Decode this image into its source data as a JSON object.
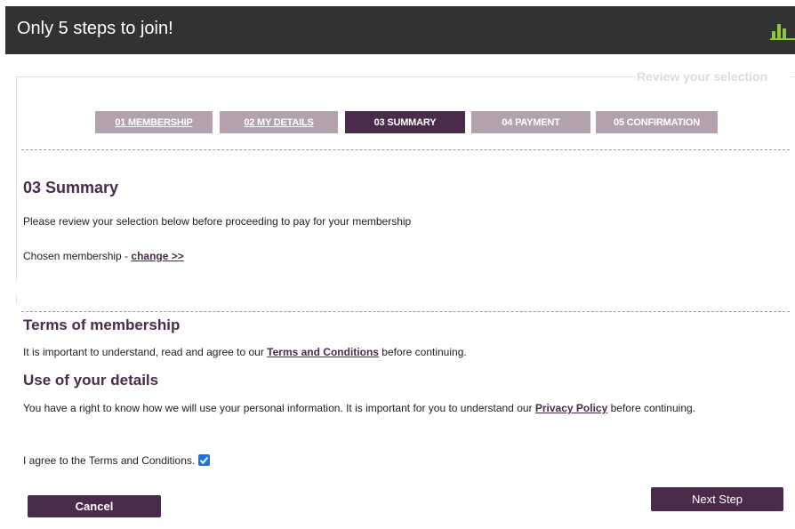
{
  "header": {
    "title": "Only 5 steps to join!",
    "icon": "bar-chart-icon"
  },
  "frame": {
    "legend": "Review your selection"
  },
  "steps": [
    {
      "label": "01 MEMBERSHIP",
      "state": "done"
    },
    {
      "label": "02 MY DETAILS",
      "state": "done"
    },
    {
      "label": "03 SUMMARY",
      "state": "active"
    },
    {
      "label": "04 PAYMENT",
      "state": "pending"
    },
    {
      "label": "05 CONFIRMATION",
      "state": "pending"
    }
  ],
  "summary": {
    "heading": "03 Summary",
    "intro": "Please review your selection below before proceeding to pay for your membership",
    "chosen_label": "Chosen membership - ",
    "change_link": "change >>"
  },
  "terms": {
    "heading": "Terms of membership",
    "text_before": "It is important to understand, read and agree to our ",
    "link": "Terms and Conditions",
    "text_after": " before continuing."
  },
  "details": {
    "heading": "Use of your details",
    "text_before": "You have a right to know how we will use your personal information. It is important for you to understand our ",
    "link": "Privacy Policy",
    "text_after": " before continuing."
  },
  "agree": {
    "label": "I agree to the Terms and Conditions.",
    "checked": true
  },
  "buttons": {
    "cancel": "Cancel",
    "next": "Next Step"
  },
  "colors": {
    "header_bg": "#323232",
    "accent": "#4a2b49",
    "step_inactive": "#b3a1ae",
    "checkbox": "#1a73e8",
    "header_icon": "#8dc63f"
  }
}
